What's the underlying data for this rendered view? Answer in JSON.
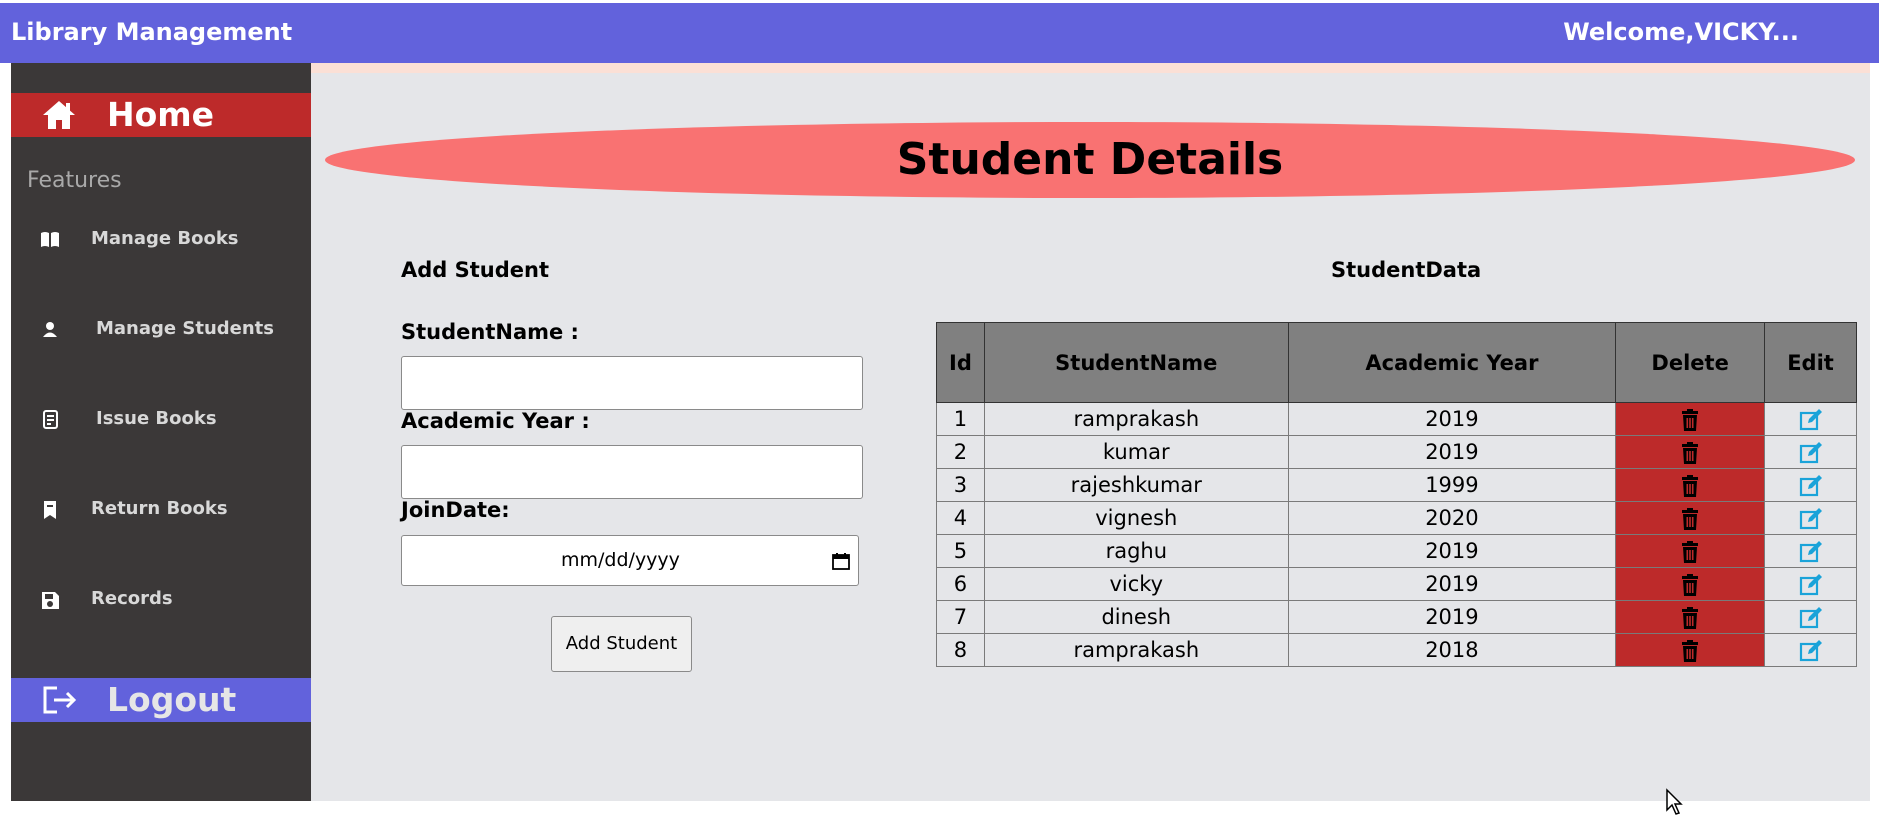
{
  "header": {
    "app_title": "Library Management",
    "welcome": "Welcome,VICKY..."
  },
  "sidebar": {
    "home_label": "Home",
    "features_label": "Features",
    "items": [
      {
        "label": "Manage Books",
        "icon": "book-open-icon"
      },
      {
        "label": "Manage Students",
        "icon": "user-icon"
      },
      {
        "label": "Issue Books",
        "icon": "receipt-icon"
      },
      {
        "label": "Return Books",
        "icon": "bookmark-icon"
      },
      {
        "label": "Records",
        "icon": "save-icon"
      }
    ],
    "logout_label": "Logout"
  },
  "page": {
    "title": "Student Details"
  },
  "form": {
    "title": "Add Student",
    "student_name_label": "StudentName :",
    "student_name_value": "",
    "academic_year_label": "Academic Year :",
    "academic_year_value": "",
    "join_date_label": "JoinDate:",
    "join_date_placeholder": "mm/dd/yyyy",
    "submit_label": "Add Student"
  },
  "table": {
    "title": "StudentData",
    "headers": [
      "Id",
      "StudentName",
      "Academic Year",
      "Delete",
      "Edit"
    ],
    "rows": [
      {
        "id": "1",
        "name": "ramprakash",
        "year": "2019"
      },
      {
        "id": "2",
        "name": "kumar",
        "year": "2019"
      },
      {
        "id": "3",
        "name": "rajeshkumar",
        "year": "1999"
      },
      {
        "id": "4",
        "name": "vignesh",
        "year": "2020"
      },
      {
        "id": "5",
        "name": "raghu",
        "year": "2019"
      },
      {
        "id": "6",
        "name": "vicky",
        "year": "2019"
      },
      {
        "id": "7",
        "name": "dinesh",
        "year": "2019"
      },
      {
        "id": "8",
        "name": "ramprakash",
        "year": "2018"
      }
    ]
  },
  "colors": {
    "topbar": "#6262dc",
    "sidebar": "#3b3838",
    "home_active": "#bd2a2a",
    "banner": "#f97272",
    "delete_cell": "#bd2a2a",
    "edit_icon": "#1aa3d9"
  }
}
